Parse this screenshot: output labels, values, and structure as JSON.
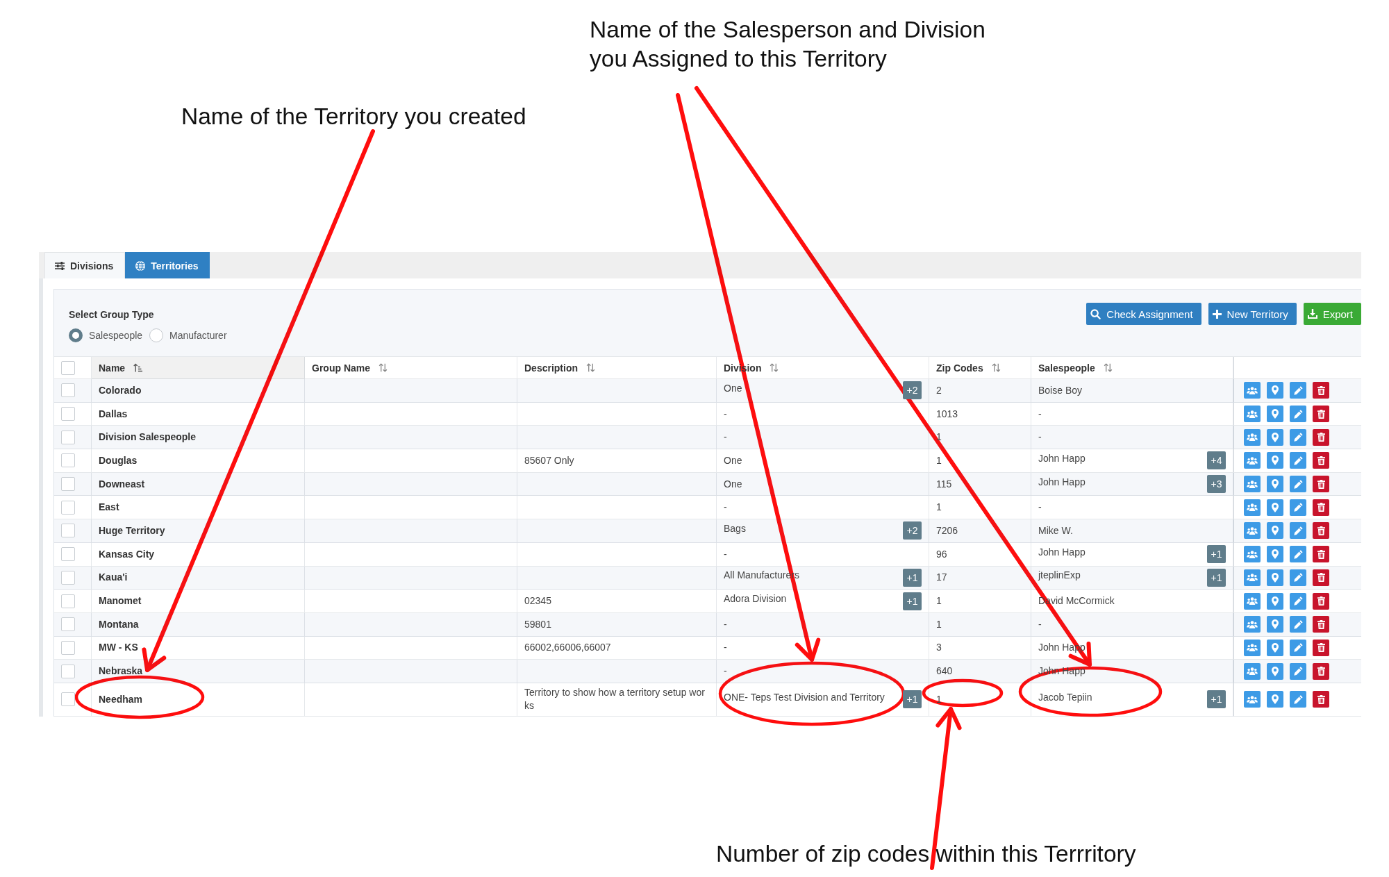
{
  "annotations": [
    {
      "lines": [
        "Name of the Salesperson and Division",
        "you Assigned to this Territory"
      ]
    },
    {
      "lines": [
        "Name of the Territory you created"
      ]
    },
    {
      "lines": [
        "Number of zip codes within this Terrritory"
      ]
    }
  ],
  "tabs": [
    {
      "label": "Divisions",
      "selected": false
    },
    {
      "label": "Territories",
      "selected": true
    }
  ],
  "group_type": {
    "label": "Select Group Type",
    "options": [
      {
        "label": "Salespeople",
        "selected": true
      },
      {
        "label": "Manufacturer",
        "selected": false
      }
    ]
  },
  "toolbar": [
    {
      "label": "Check Assignment",
      "kind": "primary"
    },
    {
      "label": "New Territory",
      "kind": "primary"
    },
    {
      "label": "Export",
      "kind": "success"
    }
  ],
  "table": {
    "select_all": {
      "checked": false
    },
    "columns": [
      {
        "label": "Name",
        "sorted": true
      },
      {
        "label": "Group Name",
        "sorted": false
      },
      {
        "label": "Description",
        "sorted": false
      },
      {
        "label": "Division",
        "sorted": false
      },
      {
        "label": "Zip Codes",
        "sorted": false
      },
      {
        "label": "Salespeople",
        "sorted": false
      }
    ],
    "rows": [
      {
        "checked": false,
        "name": "Colorado",
        "division": "One",
        "division_extra": "+2",
        "zip_codes": "2",
        "salespeople": "Boise Boy"
      },
      {
        "checked": false,
        "name": "Dallas",
        "division": "-",
        "zip_codes": "1013",
        "salespeople": "-"
      },
      {
        "checked": false,
        "name": "Division Salespeople",
        "division": "-",
        "zip_codes": "1",
        "salespeople": "-"
      },
      {
        "checked": false,
        "name": "Douglas",
        "description": "85607 Only",
        "division": "One",
        "zip_codes": "1",
        "salespeople": "John Happ",
        "salespeople_extra": "+4"
      },
      {
        "checked": false,
        "name": "Downeast",
        "division": "One",
        "zip_codes": "115",
        "salespeople": "John Happ",
        "salespeople_extra": "+3"
      },
      {
        "checked": false,
        "name": "East",
        "division": "-",
        "zip_codes": "1",
        "salespeople": "-"
      },
      {
        "checked": false,
        "name": "Huge Territory",
        "division": "Bags",
        "division_extra": "+2",
        "zip_codes": "7206",
        "salespeople": "Mike W."
      },
      {
        "checked": false,
        "name": "Kansas City",
        "division": "-",
        "zip_codes": "96",
        "salespeople": "John Happ",
        "salespeople_extra": "+1"
      },
      {
        "checked": false,
        "name": "Kaua'i",
        "division": "All Manufacturers",
        "division_extra": "+1",
        "zip_codes": "17",
        "salespeople": "jteplinExp",
        "salespeople_extra": "+1"
      },
      {
        "checked": false,
        "name": "Manomet",
        "description": "02345",
        "division": "Adora Division",
        "division_extra": "+1",
        "zip_codes": "1",
        "salespeople": "David McCormick"
      },
      {
        "checked": false,
        "name": "Montana",
        "description": "59801",
        "division": "-",
        "zip_codes": "1",
        "salespeople": "-"
      },
      {
        "checked": false,
        "name": "MW - KS",
        "description": "66002,66006,66007",
        "division": "-",
        "zip_codes": "3",
        "salespeople": "John Happ"
      },
      {
        "checked": false,
        "name": "Nebraska",
        "division": "-",
        "zip_codes": "640",
        "salespeople": "John Happ"
      },
      {
        "checked": false,
        "name": "Needham",
        "description": "Territory to show how a territory setup works",
        "division": "ONE- Teps Test Division and Territory",
        "division_extra": "+1",
        "zip_codes": "1",
        "salespeople": "Jacob Tepiin",
        "salespeople_extra": "+1"
      }
    ]
  }
}
